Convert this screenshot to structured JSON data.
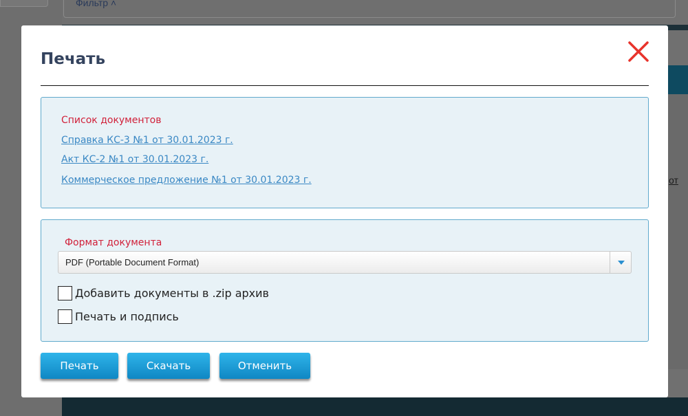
{
  "background": {
    "filter_label": "Фильтр ˄",
    "right_link": "от"
  },
  "modal": {
    "title": "Печать",
    "documents": {
      "label": "Список документов",
      "items": [
        "Справка КС-3 №1 от 30.01.2023 г.",
        "Акт КС-2 №1 от 30.01.2023 г.",
        "Коммерческое предложение №1 от 30.01.2023 г."
      ]
    },
    "format": {
      "label": "Формат документа",
      "selected": "PDF (Portable Document Format)"
    },
    "options": {
      "zip_label": "Добавить документы в .zip архив",
      "sign_label": "Печать и подпись"
    },
    "buttons": {
      "print": "Печать",
      "download": "Скачать",
      "cancel": "Отменить"
    }
  },
  "colors": {
    "accent": "#1a9bd7",
    "label_red": "#d1213a",
    "link": "#3a88c4",
    "close": "#e8332b",
    "title": "#34435e"
  }
}
